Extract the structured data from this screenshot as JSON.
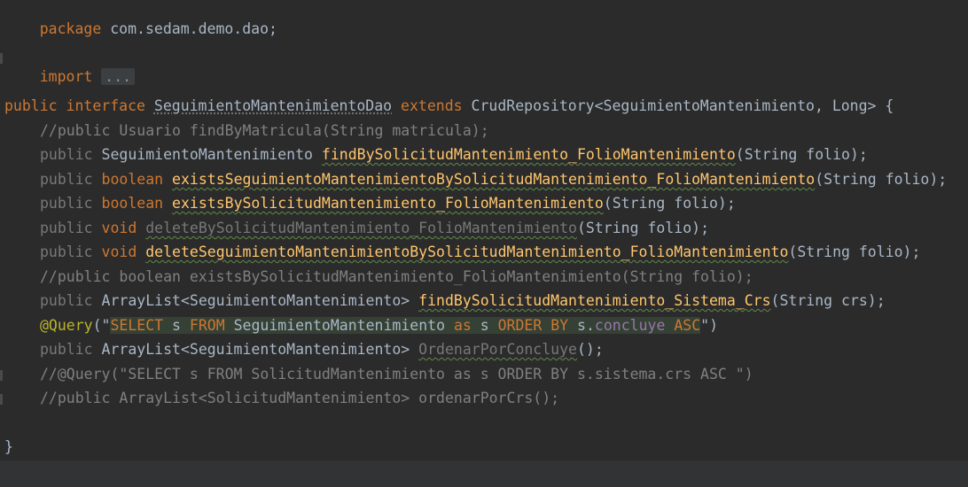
{
  "editor": {
    "package_kw": "package",
    "package_name": "com.sedam.demo.dao;",
    "import_kw": "import",
    "import_folded": "...",
    "lines": {
      "decl": {
        "public": "public",
        "interface": "interface",
        "name": "SeguimientoMantenimientoDao",
        "extends": "extends",
        "rest": "CrudRepository<SeguimientoMantenimiento, Long> {"
      },
      "l1": "//public Usuario findByMatricula(String matricula);",
      "l2": {
        "public": "public",
        "type": "SeguimientoMantenimiento",
        "method": "findBySolicitudMantenimiento_FolioMantenimiento",
        "params": "(String folio);"
      },
      "l3": {
        "public": "public",
        "type": "boolean",
        "method": "existsSeguimientoMantenimientoBySolicitudMantenimiento_FolioMantenimiento",
        "params": "(String folio);"
      },
      "l4": {
        "public": "public",
        "type": "boolean",
        "method": "existsBySolicitudMantenimiento_FolioMantenimiento",
        "params": "(String folio);"
      },
      "l5": {
        "public": "public",
        "type": "void",
        "method": "deleteBySolicitudMantenimiento_FolioMantenimiento",
        "params": "(String folio);"
      },
      "l6": {
        "public": "public",
        "type": "void",
        "method": "deleteSeguimientoMantenimientoBySolicitudMantenimiento_FolioMantenimiento",
        "params": "(String folio);"
      },
      "l7": "//public boolean existsBySolicitudMantenimiento_FolioMantenimiento(String folio);",
      "l8": {
        "public": "public",
        "type": "ArrayList<SeguimientoMantenimiento>",
        "method": "findBySolicitudMantenimiento_Sistema_Crs",
        "params": "(String crs);"
      },
      "l9": {
        "annotation": "@Query",
        "open": "(\"",
        "select": "SELECT",
        "s1": " s ",
        "from": "FROM",
        "entity": " SeguimientoMantenimiento ",
        "as": "as",
        "s2": " s ",
        "orderby": "ORDER BY",
        "s3": " s.",
        "field": "concluye",
        "s4": " ",
        "asc": "ASC",
        "close": "\")"
      },
      "l10": {
        "public": "public",
        "type": "ArrayList<SeguimientoMantenimiento>",
        "method": "OrdenarPorConcluye",
        "params": "();"
      },
      "l11": "//@Query(\"SELECT s FROM SolicitudMantenimiento as s ORDER BY s.sistema.crs ASC \")",
      "l12": "//public ArrayList<SolicitudMantenimiento> ordenarPorCrs();",
      "close": "}"
    }
  }
}
